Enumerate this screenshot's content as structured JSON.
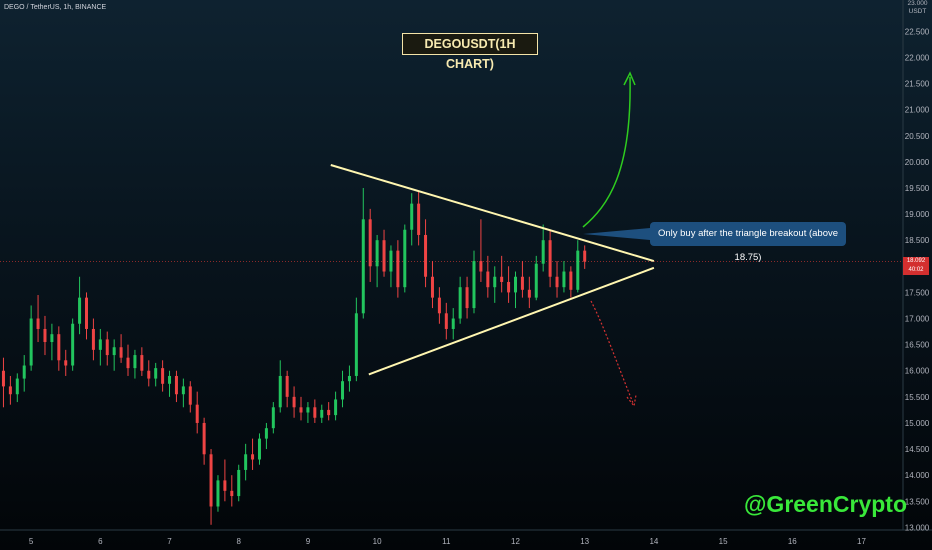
{
  "header": {
    "symbol": "DEGO / TetherUS, 1h, BINANCE"
  },
  "title": "DEGOUSDT(1H CHART)",
  "annotation": "Only buy after the triangle breakout (above 18.75)",
  "watermark": "@GreenCrypto",
  "price_axis": {
    "currency": "USDT",
    "top_value": "23.000",
    "current_price": "18.092",
    "countdown": "40:02",
    "ticks": [
      "22.500",
      "22.000",
      "21.500",
      "21.000",
      "20.500",
      "20.000",
      "19.500",
      "19.000",
      "18.500",
      "18.000",
      "17.500",
      "17.000",
      "16.500",
      "16.000",
      "15.500",
      "15.000",
      "14.500",
      "14.000",
      "13.500",
      "13.000"
    ]
  },
  "time_axis": {
    "ticks": [
      "5",
      "6",
      "7",
      "8",
      "9",
      "10",
      "11",
      "12",
      "13",
      "14",
      "15",
      "16",
      "17"
    ]
  },
  "colors": {
    "up": "#22c55e",
    "down": "#ef4444",
    "trendline": "#fff6b0",
    "breakout_arrow": "#2ecc1f",
    "breakdown_arrow": "#d83232",
    "price_line": "#8a2a2a"
  },
  "chart_data": {
    "type": "candlestick",
    "price_range": [
      12.95,
      23.1
    ],
    "x_range": [
      4.55,
      17.6
    ],
    "current_price": 18.092,
    "candles": [
      {
        "x": 4.6,
        "o": 16.0,
        "h": 16.25,
        "l": 15.3,
        "c": 15.7
      },
      {
        "x": 4.7,
        "o": 15.7,
        "h": 15.9,
        "l": 15.35,
        "c": 15.55
      },
      {
        "x": 4.8,
        "o": 15.55,
        "h": 15.95,
        "l": 15.4,
        "c": 15.85
      },
      {
        "x": 4.9,
        "o": 15.85,
        "h": 16.3,
        "l": 15.6,
        "c": 16.1
      },
      {
        "x": 5.0,
        "o": 16.1,
        "h": 17.25,
        "l": 16.0,
        "c": 17.0
      },
      {
        "x": 5.1,
        "o": 17.0,
        "h": 17.45,
        "l": 16.55,
        "c": 16.8
      },
      {
        "x": 5.2,
        "o": 16.8,
        "h": 17.05,
        "l": 16.3,
        "c": 16.55
      },
      {
        "x": 5.3,
        "o": 16.55,
        "h": 16.9,
        "l": 16.2,
        "c": 16.7
      },
      {
        "x": 5.4,
        "o": 16.7,
        "h": 16.85,
        "l": 16.0,
        "c": 16.2
      },
      {
        "x": 5.5,
        "o": 16.2,
        "h": 16.4,
        "l": 15.9,
        "c": 16.1
      },
      {
        "x": 5.6,
        "o": 16.1,
        "h": 17.0,
        "l": 16.0,
        "c": 16.9
      },
      {
        "x": 5.7,
        "o": 16.9,
        "h": 17.8,
        "l": 16.7,
        "c": 17.4
      },
      {
        "x": 5.8,
        "o": 17.4,
        "h": 17.5,
        "l": 16.6,
        "c": 16.8
      },
      {
        "x": 5.9,
        "o": 16.8,
        "h": 17.0,
        "l": 16.2,
        "c": 16.4
      },
      {
        "x": 6.0,
        "o": 16.4,
        "h": 16.8,
        "l": 16.1,
        "c": 16.6
      },
      {
        "x": 6.1,
        "o": 16.6,
        "h": 16.75,
        "l": 16.1,
        "c": 16.3
      },
      {
        "x": 6.2,
        "o": 16.3,
        "h": 16.6,
        "l": 16.0,
        "c": 16.45
      },
      {
        "x": 6.3,
        "o": 16.45,
        "h": 16.7,
        "l": 16.15,
        "c": 16.25
      },
      {
        "x": 6.4,
        "o": 16.25,
        "h": 16.5,
        "l": 15.9,
        "c": 16.05
      },
      {
        "x": 6.5,
        "o": 16.05,
        "h": 16.4,
        "l": 15.85,
        "c": 16.3
      },
      {
        "x": 6.6,
        "o": 16.3,
        "h": 16.45,
        "l": 15.9,
        "c": 16.0
      },
      {
        "x": 6.7,
        "o": 16.0,
        "h": 16.2,
        "l": 15.7,
        "c": 15.85
      },
      {
        "x": 6.8,
        "o": 15.85,
        "h": 16.15,
        "l": 15.7,
        "c": 16.05
      },
      {
        "x": 6.9,
        "o": 16.05,
        "h": 16.2,
        "l": 15.6,
        "c": 15.75
      },
      {
        "x": 7.0,
        "o": 15.75,
        "h": 16.0,
        "l": 15.5,
        "c": 15.9
      },
      {
        "x": 7.1,
        "o": 15.9,
        "h": 16.0,
        "l": 15.4,
        "c": 15.55
      },
      {
        "x": 7.2,
        "o": 15.55,
        "h": 15.85,
        "l": 15.3,
        "c": 15.7
      },
      {
        "x": 7.3,
        "o": 15.7,
        "h": 15.8,
        "l": 15.2,
        "c": 15.35
      },
      {
        "x": 7.4,
        "o": 15.35,
        "h": 15.6,
        "l": 14.8,
        "c": 15.0
      },
      {
        "x": 7.5,
        "o": 15.0,
        "h": 15.1,
        "l": 14.2,
        "c": 14.4
      },
      {
        "x": 7.6,
        "o": 14.4,
        "h": 14.5,
        "l": 13.05,
        "c": 13.4
      },
      {
        "x": 7.7,
        "o": 13.4,
        "h": 14.0,
        "l": 13.3,
        "c": 13.9
      },
      {
        "x": 7.8,
        "o": 13.9,
        "h": 14.3,
        "l": 13.5,
        "c": 13.7
      },
      {
        "x": 7.9,
        "o": 13.7,
        "h": 14.0,
        "l": 13.4,
        "c": 13.6
      },
      {
        "x": 8.0,
        "o": 13.6,
        "h": 14.2,
        "l": 13.5,
        "c": 14.1
      },
      {
        "x": 8.1,
        "o": 14.1,
        "h": 14.6,
        "l": 13.9,
        "c": 14.4
      },
      {
        "x": 8.2,
        "o": 14.4,
        "h": 14.7,
        "l": 14.1,
        "c": 14.3
      },
      {
        "x": 8.3,
        "o": 14.3,
        "h": 14.8,
        "l": 14.2,
        "c": 14.7
      },
      {
        "x": 8.4,
        "o": 14.7,
        "h": 15.0,
        "l": 14.5,
        "c": 14.9
      },
      {
        "x": 8.5,
        "o": 14.9,
        "h": 15.4,
        "l": 14.8,
        "c": 15.3
      },
      {
        "x": 8.6,
        "o": 15.3,
        "h": 16.2,
        "l": 15.2,
        "c": 15.9
      },
      {
        "x": 8.7,
        "o": 15.9,
        "h": 16.0,
        "l": 15.3,
        "c": 15.5
      },
      {
        "x": 8.8,
        "o": 15.5,
        "h": 15.7,
        "l": 15.1,
        "c": 15.3
      },
      {
        "x": 8.9,
        "o": 15.3,
        "h": 15.5,
        "l": 15.05,
        "c": 15.2
      },
      {
        "x": 9.0,
        "o": 15.2,
        "h": 15.4,
        "l": 15.0,
        "c": 15.3
      },
      {
        "x": 9.1,
        "o": 15.3,
        "h": 15.45,
        "l": 15.0,
        "c": 15.1
      },
      {
        "x": 9.2,
        "o": 15.1,
        "h": 15.35,
        "l": 15.0,
        "c": 15.25
      },
      {
        "x": 9.3,
        "o": 15.25,
        "h": 15.4,
        "l": 15.05,
        "c": 15.15
      },
      {
        "x": 9.4,
        "o": 15.15,
        "h": 15.6,
        "l": 15.05,
        "c": 15.45
      },
      {
        "x": 9.5,
        "o": 15.45,
        "h": 16.0,
        "l": 15.3,
        "c": 15.8
      },
      {
        "x": 9.6,
        "o": 15.8,
        "h": 16.1,
        "l": 15.6,
        "c": 15.9
      },
      {
        "x": 9.7,
        "o": 15.9,
        "h": 17.4,
        "l": 15.8,
        "c": 17.1
      },
      {
        "x": 9.8,
        "o": 17.1,
        "h": 19.5,
        "l": 17.0,
        "c": 18.9
      },
      {
        "x": 9.9,
        "o": 18.9,
        "h": 19.1,
        "l": 17.7,
        "c": 18.0
      },
      {
        "x": 10.0,
        "o": 18.0,
        "h": 18.6,
        "l": 17.6,
        "c": 18.5
      },
      {
        "x": 10.1,
        "o": 18.5,
        "h": 18.7,
        "l": 17.8,
        "c": 17.9
      },
      {
        "x": 10.2,
        "o": 17.9,
        "h": 18.4,
        "l": 17.6,
        "c": 18.3
      },
      {
        "x": 10.3,
        "o": 18.3,
        "h": 18.5,
        "l": 17.4,
        "c": 17.6
      },
      {
        "x": 10.4,
        "o": 17.6,
        "h": 18.8,
        "l": 17.5,
        "c": 18.7
      },
      {
        "x": 10.5,
        "o": 18.7,
        "h": 19.4,
        "l": 18.4,
        "c": 19.2
      },
      {
        "x": 10.6,
        "o": 19.2,
        "h": 19.45,
        "l": 18.4,
        "c": 18.6
      },
      {
        "x": 10.7,
        "o": 18.6,
        "h": 18.9,
        "l": 17.6,
        "c": 17.8
      },
      {
        "x": 10.8,
        "o": 17.8,
        "h": 18.1,
        "l": 17.2,
        "c": 17.4
      },
      {
        "x": 10.9,
        "o": 17.4,
        "h": 17.6,
        "l": 16.9,
        "c": 17.1
      },
      {
        "x": 11.0,
        "o": 17.1,
        "h": 17.3,
        "l": 16.6,
        "c": 16.8
      },
      {
        "x": 11.1,
        "o": 16.8,
        "h": 17.2,
        "l": 16.6,
        "c": 17.0
      },
      {
        "x": 11.2,
        "o": 17.0,
        "h": 17.8,
        "l": 16.9,
        "c": 17.6
      },
      {
        "x": 11.3,
        "o": 17.6,
        "h": 17.8,
        "l": 17.0,
        "c": 17.2
      },
      {
        "x": 11.4,
        "o": 17.2,
        "h": 18.3,
        "l": 17.1,
        "c": 18.1
      },
      {
        "x": 11.5,
        "o": 18.1,
        "h": 18.9,
        "l": 17.7,
        "c": 17.9
      },
      {
        "x": 11.6,
        "o": 17.9,
        "h": 18.2,
        "l": 17.4,
        "c": 17.6
      },
      {
        "x": 11.7,
        "o": 17.6,
        "h": 18.0,
        "l": 17.3,
        "c": 17.8
      },
      {
        "x": 11.8,
        "o": 17.8,
        "h": 18.2,
        "l": 17.5,
        "c": 17.7
      },
      {
        "x": 11.9,
        "o": 17.7,
        "h": 18.0,
        "l": 17.3,
        "c": 17.5
      },
      {
        "x": 12.0,
        "o": 17.5,
        "h": 17.9,
        "l": 17.2,
        "c": 17.8
      },
      {
        "x": 12.1,
        "o": 17.8,
        "h": 18.1,
        "l": 17.4,
        "c": 17.55
      },
      {
        "x": 12.2,
        "o": 17.55,
        "h": 17.8,
        "l": 17.2,
        "c": 17.4
      },
      {
        "x": 12.3,
        "o": 17.4,
        "h": 18.2,
        "l": 17.35,
        "c": 18.05
      },
      {
        "x": 12.4,
        "o": 18.05,
        "h": 18.8,
        "l": 17.9,
        "c": 18.5
      },
      {
        "x": 12.5,
        "o": 18.5,
        "h": 18.7,
        "l": 17.6,
        "c": 17.8
      },
      {
        "x": 12.6,
        "o": 17.8,
        "h": 18.1,
        "l": 17.4,
        "c": 17.6
      },
      {
        "x": 12.7,
        "o": 17.6,
        "h": 18.1,
        "l": 17.5,
        "c": 17.9
      },
      {
        "x": 12.8,
        "o": 17.9,
        "h": 18.0,
        "l": 17.4,
        "c": 17.55
      },
      {
        "x": 12.9,
        "o": 17.55,
        "h": 18.5,
        "l": 17.5,
        "c": 18.3
      },
      {
        "x": 13.0,
        "o": 18.3,
        "h": 18.4,
        "l": 17.95,
        "c": 18.09
      }
    ],
    "trendlines": [
      {
        "name": "resistance",
        "x1": 9.33,
        "y1": 19.94,
        "x2": 14.0,
        "y2": 18.1
      },
      {
        "name": "support",
        "x1": 9.88,
        "y1": 15.93,
        "x2": 14.0,
        "y2": 17.97
      }
    ]
  }
}
